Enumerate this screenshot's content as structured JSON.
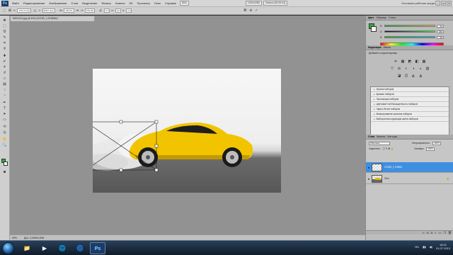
{
  "menubar": {
    "logo": "Ps",
    "items": [
      "Файл",
      "Редактирование",
      "Изображение",
      "Слои",
      "Выделение",
      "Фильтр",
      "Анализ",
      "3D",
      "Просмотр",
      "Окно",
      "Справка"
    ],
    "zoom": "50%",
    "screen_size": "1920x1080",
    "recording": "Запись [00:00:41]",
    "workspace": "Основная рабочая среда",
    "window_buttons": [
      "–",
      "▭",
      "✕"
    ]
  },
  "options": {
    "x_value": "1471,0 пикс",
    "y_value": "468,0 пикс",
    "w_value": "100,0%",
    "h_value": "100,0%",
    "angle": "0,0",
    "h_skew": "0,0",
    "v_skew": "0,0",
    "icons": [
      "move-icon",
      "warp-icon",
      "cancel-icon",
      "commit-icon"
    ]
  },
  "document": {
    "tab_title": "IMG1312.jpg @ 50% (СЛОЙ_1,RGB/8#) *",
    "status_zoom": "50%",
    "status_doc": "Док: 4,40M/4,40M",
    "canvas_description_alt": ""
  },
  "colors": {
    "foreground": "#1fb53a",
    "background": "#ffffff",
    "accent_selection": "#3e8fe0"
  },
  "panels": {
    "color_tabs": [
      "Цвет",
      "Образцы",
      "Стили"
    ],
    "color_sliders": [
      {
        "label": "R",
        "value": "31",
        "gradient": "linear-gradient(90deg,#00b53a,#ffb53a)"
      },
      {
        "label": "G",
        "value": "181",
        "gradient": "linear-gradient(90deg,#1f003a,#1fff3a)"
      },
      {
        "label": "B",
        "value": "58",
        "gradient": "linear-gradient(90deg,#1fb500,#1fb5ff)"
      }
    ],
    "adjust_tabs": [
      "Коррекция",
      "Маски"
    ],
    "adjust_title": "Добавить корректировку",
    "adjust_icons_row1": [
      "☀",
      "▩",
      "◩",
      "◧",
      "▦"
    ],
    "adjust_icons_row2": [
      "▽",
      "⚖",
      "◐",
      "◑",
      "◒",
      "▥"
    ],
    "adjust_icons_row3": [
      "◪",
      "◫",
      "◭",
      "◮"
    ],
    "presets": [
      "Уровни наборов",
      "Кривые наборов",
      "Экспозиция наборов",
      "Цветовой тон/Насыщенность наборов",
      "Черно-белое наборов",
      "Микширование каналов наборов",
      "Выборочная коррекция цвета наборов"
    ],
    "layers_tabs": [
      "Слои",
      "Каналы",
      "Контуры"
    ],
    "blend_mode": "Обычные",
    "opacity_label": "Непрозрачность:",
    "opacity_value": "100%",
    "lock_label": "Закрепить:",
    "fill_label": "Заливка:",
    "fill_value": "100%",
    "layers": [
      {
        "name": "СЛОЙ_1 FWBS",
        "selected": true,
        "thumb": "transparent"
      },
      {
        "name": "Фон",
        "selected": false,
        "thumb": "car"
      }
    ],
    "footer_icons": [
      "link-icon",
      "fx-icon",
      "mask-icon",
      "adjust-icon",
      "folder-icon",
      "new-layer-icon",
      "trash-icon"
    ]
  },
  "taskbar": {
    "icons": [
      "📁",
      "▶",
      "🌐",
      "🌀",
      "Ps"
    ],
    "language": "RU",
    "time": "18:41",
    "date": "01.07.2013"
  }
}
